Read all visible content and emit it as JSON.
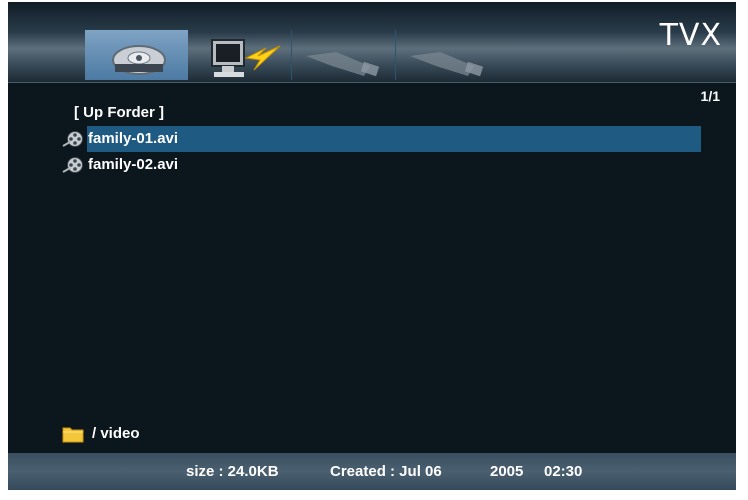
{
  "header": {
    "brand": "TVX",
    "tabs": [
      {
        "icon": "hard-drive-icon",
        "active": true
      },
      {
        "icon": "network-pc-icon",
        "active": false
      },
      {
        "icon": "usb-icon",
        "active": false
      },
      {
        "icon": "usb-icon",
        "active": false
      }
    ]
  },
  "page_indicator": "1/1",
  "file_list": {
    "up_folder": "[ Up Forder ]",
    "items": [
      {
        "name": "family-01.avi",
        "icon": "film-reel-icon",
        "selected": true
      },
      {
        "name": "family-02.avi",
        "icon": "film-reel-icon",
        "selected": false
      }
    ]
  },
  "current_path": {
    "icon": "folder-icon",
    "label": "/ video"
  },
  "status_bar": {
    "size": "size : 24.0KB",
    "created": "Created : Jul 06",
    "year": "2005",
    "time": "02:30"
  },
  "colors": {
    "background": "#0c161d",
    "highlight": "#1e5a82",
    "text": "#ffffff"
  }
}
